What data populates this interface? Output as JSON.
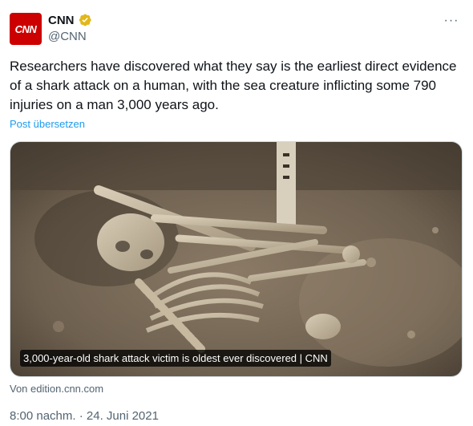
{
  "author": {
    "display_name": "CNN",
    "handle": "@CNN",
    "avatar_text": "CNN",
    "avatar_color": "#cc0000",
    "verified_badge": "gold-check-icon"
  },
  "menu": {
    "more_label": "···"
  },
  "tweet": {
    "text": "Researchers have discovered what they say is the earliest direct evidence of a shark attack on a human, with the sea creature inflicting some 790 injuries on a man 3,000 years ago.",
    "translate_label": "Post übersetzen"
  },
  "media": {
    "caption": "3,000-year-old shark attack victim is oldest ever discovered | CNN",
    "source": "Von edition.cnn.com"
  },
  "meta": {
    "timestamp": "8:00 nachm. · 24. Juni 2021"
  },
  "colors": {
    "link": "#1d9bf0",
    "secondary_text": "#536471",
    "primary_text": "#0f1419"
  }
}
